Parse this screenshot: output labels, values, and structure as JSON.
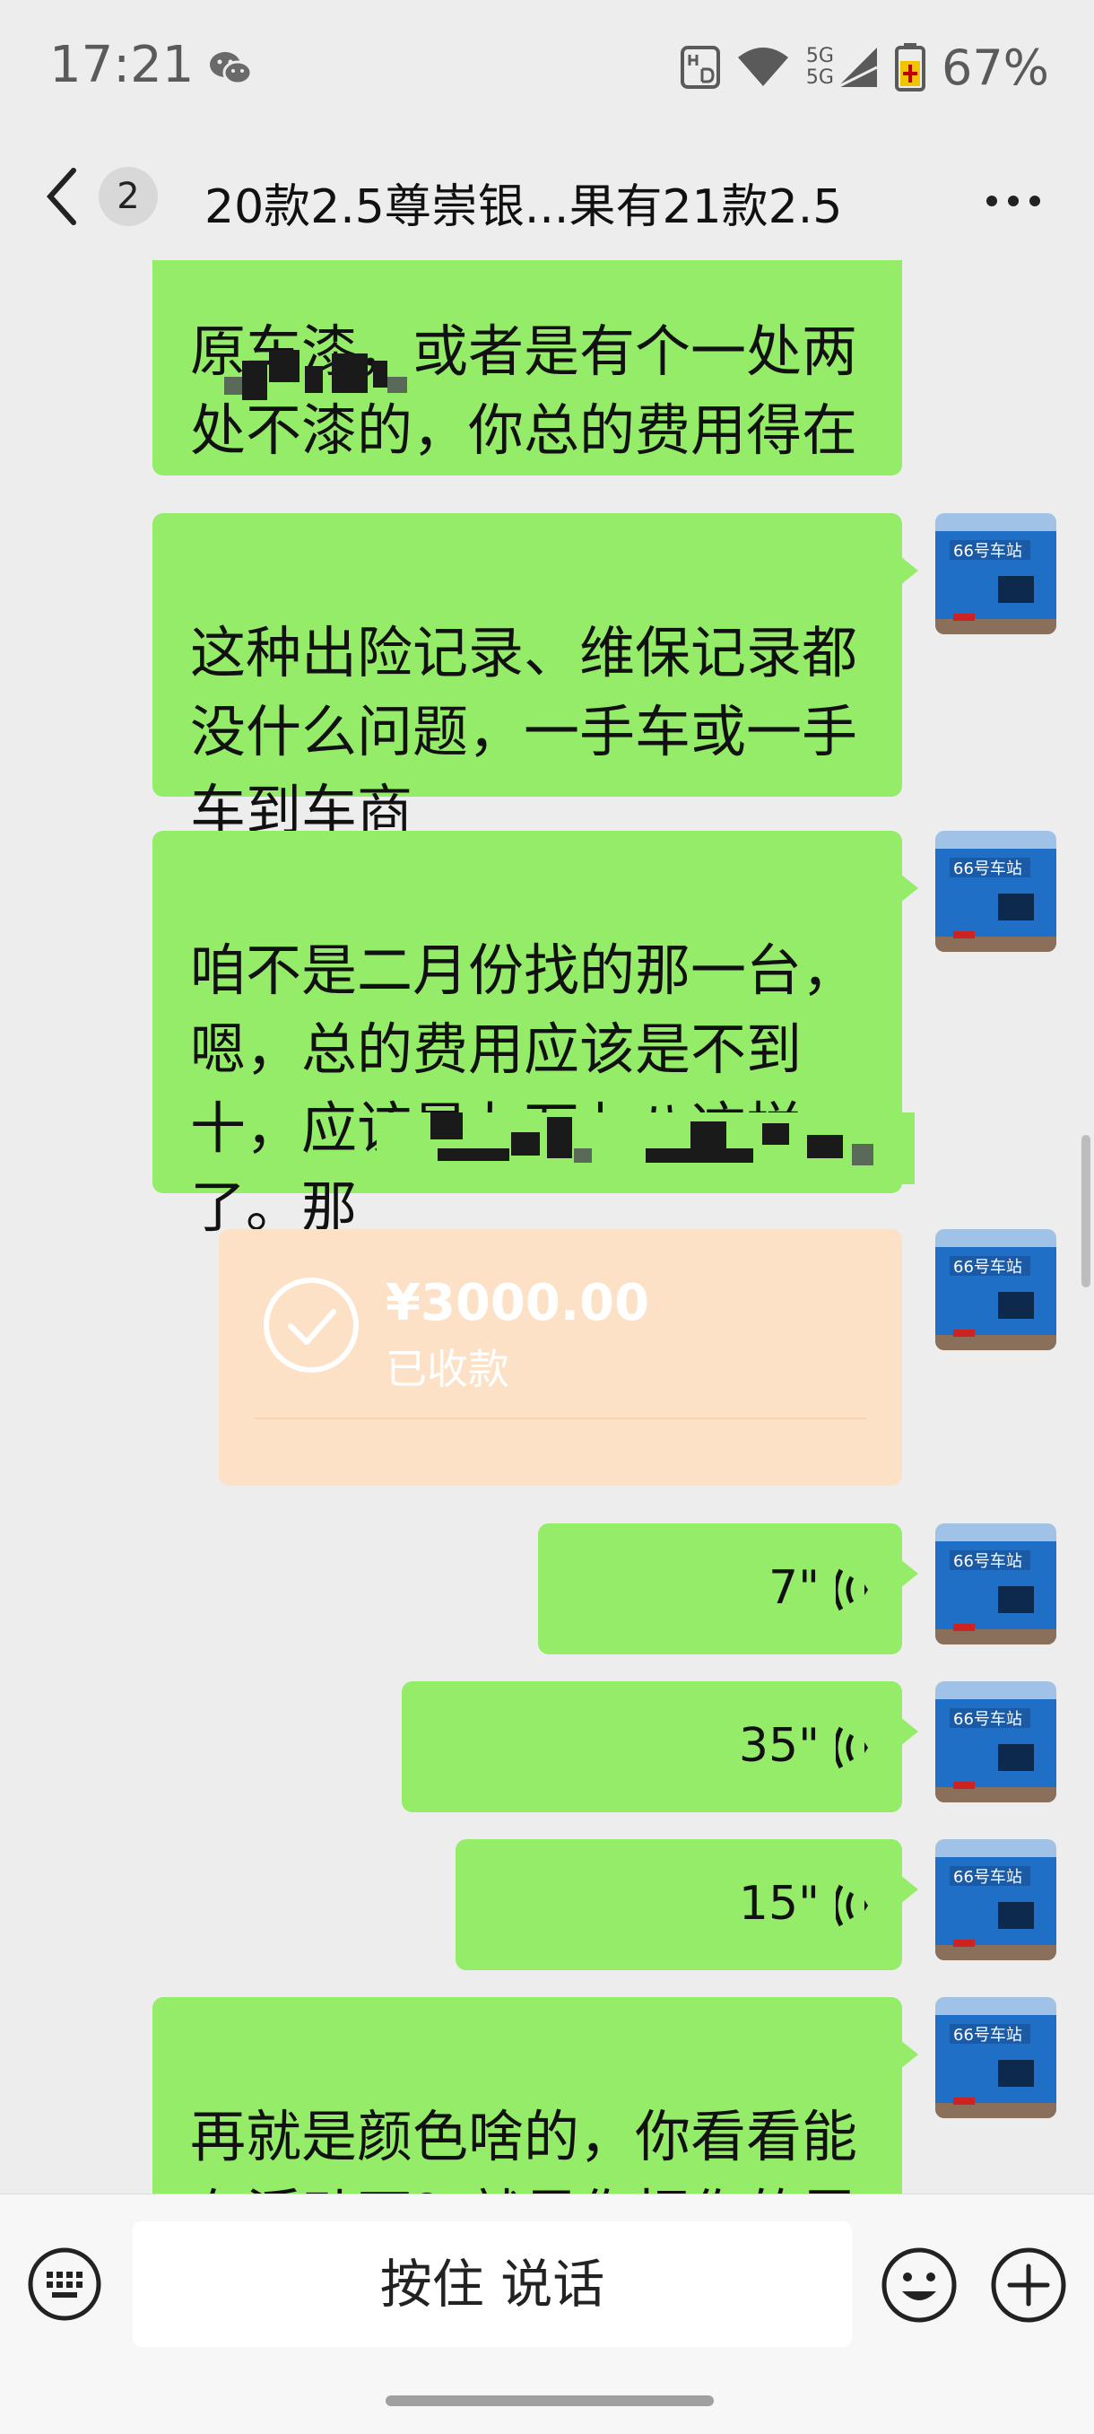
{
  "status_bar": {
    "time": "17:21",
    "network_top": "5G",
    "network_bottom": "5G",
    "battery": "67%",
    "icons": [
      "wechat-icon",
      "hd-icon",
      "wifi-icon",
      "signal-icon",
      "battery-icon"
    ]
  },
  "title_bar": {
    "unread_count": "2",
    "title": "20款2.5尊崇银...果有21款2.5",
    "icons": [
      "back-arrow-icon",
      "more-icon"
    ]
  },
  "messages": [
    {
      "type": "text",
      "text": "原车漆，或者是有个一处两\n处不漆的，你总的费用得在"
    },
    {
      "type": "text",
      "text": "这种出险记录、维保记录都\n没什么问题，一手车或一手\n车到车商"
    },
    {
      "type": "text",
      "text": "咱不是二月份找的那一台，\n嗯，总的费用应该是不到\n十，应该是九万七八这样\n了。那"
    },
    {
      "type": "transfer",
      "amount": "¥3000.00",
      "status": "已收款"
    },
    {
      "type": "voice",
      "duration": "7\""
    },
    {
      "type": "voice",
      "duration": "35\""
    },
    {
      "type": "voice",
      "duration": "15\""
    },
    {
      "type": "text",
      "text": "再就是颜色啥的，你看看能\n有浮动不？就是你把你的需"
    }
  ],
  "avatar": {
    "label": "66号车站",
    "bg": "#1f6fc6"
  },
  "input_bar": {
    "hold_to_talk": "按住 说话",
    "icons": [
      "keyboard-icon",
      "emoji-icon",
      "plus-icon"
    ]
  },
  "colors": {
    "bubble": "#95ec69",
    "transfer": "#fde1c6",
    "background": "#ededed"
  }
}
